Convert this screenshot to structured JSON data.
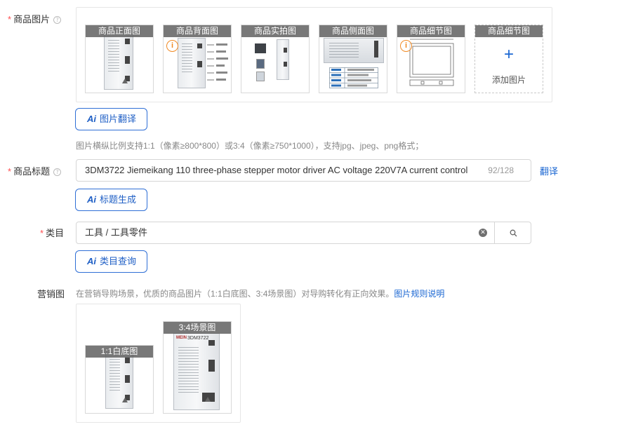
{
  "product_images": {
    "label": "商品图片",
    "thumbnails": [
      {
        "caption": "商品正面图",
        "warning": false
      },
      {
        "caption": "商品背面图",
        "warning": true
      },
      {
        "caption": "商品实拍图",
        "warning": false
      },
      {
        "caption": "商品侧面图",
        "warning": false
      },
      {
        "caption": "商品细节图",
        "warning": true
      },
      {
        "caption": "商品细节图",
        "add_label": "添加图片"
      }
    ],
    "translate_button": "图片翻译",
    "hint": "图片横纵比例支持1:1（像素≥800*800）或3:4（像素≥750*1000），支持jpg、jpeg、png格式；"
  },
  "title": {
    "label": "商品标题",
    "value": "3DM3722 Jiemeikang 110 three-phase stepper motor driver AC voltage 220V7A current control",
    "count": "92/128",
    "translate_link": "翻译",
    "generate_button": "标题生成"
  },
  "category": {
    "label": "类目",
    "value": "工具 / 工具零件",
    "query_button": "类目查询"
  },
  "marketing": {
    "label": "营销图",
    "hint": "在营销导购场景，优质的商品图片（1:1白底图、3:4场景图）对导购转化有正向效果。",
    "hint_link": "图片规则说明",
    "images": [
      {
        "caption": "1:1白底图"
      },
      {
        "caption": "3:4场景图",
        "brand_text": "MEIN",
        "model_text": "3DM3722"
      }
    ]
  },
  "ai_badge": "Ai",
  "colors": {
    "accent": "#1a66d2",
    "required": "#ff4d4f",
    "warning": "#f08a24"
  }
}
